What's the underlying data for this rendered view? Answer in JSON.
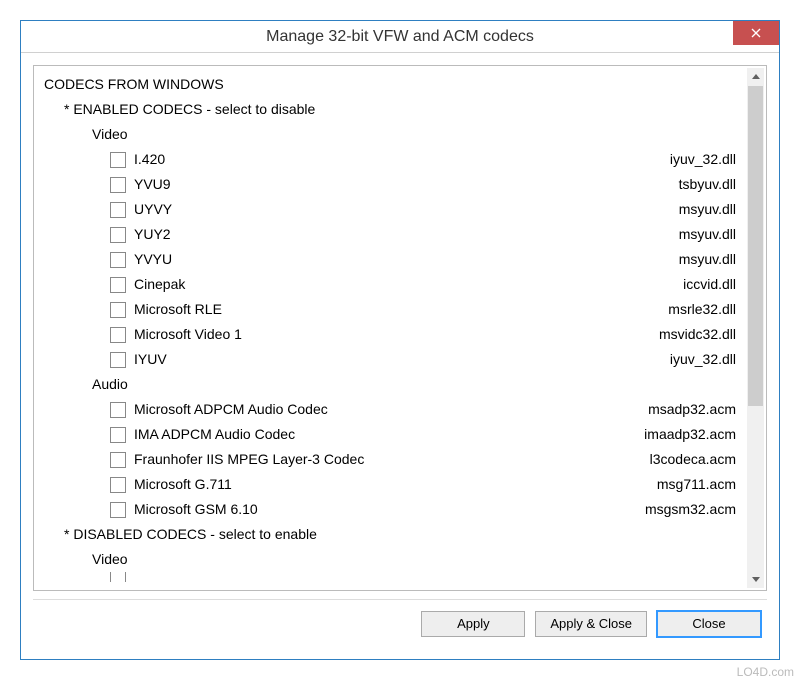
{
  "window": {
    "title": "Manage 32-bit VFW and ACM codecs"
  },
  "headings": {
    "root": "CODECS FROM WINDOWS",
    "enabled": "* ENABLED CODECS  -  select to disable",
    "disabled": "* DISABLED CODECS  -  select to enable",
    "video": "Video",
    "audio": "Audio"
  },
  "codecs": {
    "enabled_video": [
      {
        "name": "I.420",
        "file": "iyuv_32.dll"
      },
      {
        "name": "YVU9",
        "file": "tsbyuv.dll"
      },
      {
        "name": "UYVY",
        "file": "msyuv.dll"
      },
      {
        "name": "YUY2",
        "file": "msyuv.dll"
      },
      {
        "name": "YVYU",
        "file": "msyuv.dll"
      },
      {
        "name": "Cinepak",
        "file": "iccvid.dll"
      },
      {
        "name": "Microsoft RLE",
        "file": "msrle32.dll"
      },
      {
        "name": "Microsoft Video 1",
        "file": "msvidc32.dll"
      },
      {
        "name": "IYUV",
        "file": "iyuv_32.dll"
      }
    ],
    "enabled_audio": [
      {
        "name": "Microsoft ADPCM Audio Codec",
        "file": "msadp32.acm"
      },
      {
        "name": "IMA ADPCM Audio Codec",
        "file": "imaadp32.acm"
      },
      {
        "name": "Fraunhofer IIS MPEG Layer-3 Codec",
        "file": "l3codeca.acm"
      },
      {
        "name": "Microsoft G.711",
        "file": "msg711.acm"
      },
      {
        "name": "Microsoft GSM 6.10",
        "file": "msgsm32.acm"
      }
    ]
  },
  "buttons": {
    "apply": "Apply",
    "apply_close": "Apply & Close",
    "close": "Close"
  },
  "watermark": "LO4D.com"
}
